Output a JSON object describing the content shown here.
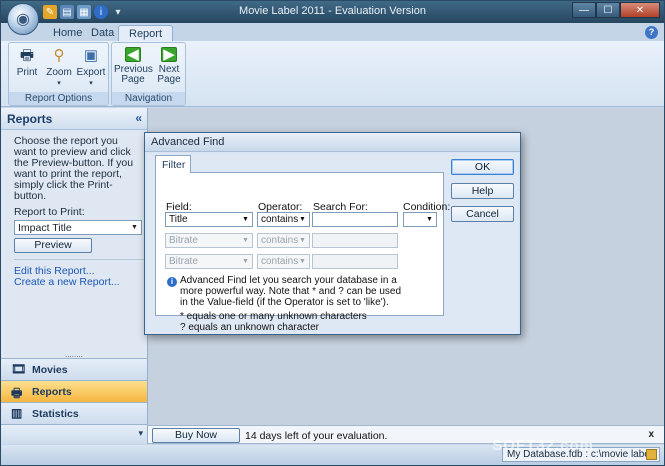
{
  "app": {
    "title": "Movie Label 2011 - Evaluation Version"
  },
  "window_controls": {
    "minimize": "—",
    "maximize": "☐",
    "close": "✕"
  },
  "ribbon": {
    "tabs": [
      {
        "label": "Home"
      },
      {
        "label": "Data"
      },
      {
        "label": "Report"
      }
    ],
    "active_tab": "Report",
    "groups": [
      {
        "label": "Report Options",
        "buttons": [
          {
            "label": "Print"
          },
          {
            "label": "Zoom"
          },
          {
            "label": "Export"
          }
        ]
      },
      {
        "label": "Navigation",
        "buttons": [
          {
            "label": "Previous Page"
          },
          {
            "label": "Next Page"
          }
        ]
      }
    ],
    "buttons": {
      "print": "Print",
      "zoom": "Zoom",
      "export": "Export",
      "previous_line1": "Previous",
      "previous_line2": "Page",
      "next_line1": "Next",
      "next_line2": "Page"
    },
    "group_labels": {
      "report_options": "Report Options",
      "navigation": "Navigation"
    }
  },
  "sidebar": {
    "header": "Reports",
    "collapse_glyph": "«",
    "instructions": "Choose the report you want to preview and click the Preview-button. If you want to print the report, simply click the Print-button.",
    "report_to_print_label": "Report to Print:",
    "report_selected": "Impact Title",
    "preview_button": "Preview",
    "links": {
      "edit": "Edit this Report...",
      "create": "Create a new Report..."
    },
    "splitter_glyph": "........",
    "nav": {
      "movies": "Movies",
      "reports": "Reports",
      "statistics": "Statistics"
    },
    "nav_bottom_glyph": "▾"
  },
  "status": {
    "buy_now": "Buy Now",
    "evaluation": "14 days left of your evaluation.",
    "close_glyph": "x"
  },
  "footer": {
    "database": "My Database.fdb  :  c:\\movie labe"
  },
  "dialog": {
    "title": "Advanced Find",
    "tab": "Filter",
    "headers": {
      "field": "Field:",
      "operator": "Operator:",
      "search_for": "Search For:",
      "condition": "Condition:"
    },
    "rows": [
      {
        "field": "Title",
        "operator": "contains",
        "search": "",
        "enabled": true
      },
      {
        "field": "Bitrate",
        "operator": "contains",
        "search": "",
        "enabled": false
      },
      {
        "field": "Bitrate",
        "operator": "contains",
        "search": "",
        "enabled": false
      }
    ],
    "condition": "",
    "info_text": "Advanced Find let you search your database in a more powerful way. Note that * and ? can be used in the Value-field (if the Operator is set to 'like').",
    "wildcard_star": "* equals one or many unknown characters",
    "wildcard_q": "? equals an unknown character",
    "buttons": {
      "ok": "OK",
      "help": "Help",
      "cancel": "Cancel"
    }
  },
  "watermark": "SOFT32.com",
  "colors": {
    "accent": "#f7b63f",
    "ribbon": "#d5e3f2",
    "titlebar": "#27465f",
    "link": "#1d56b5"
  }
}
